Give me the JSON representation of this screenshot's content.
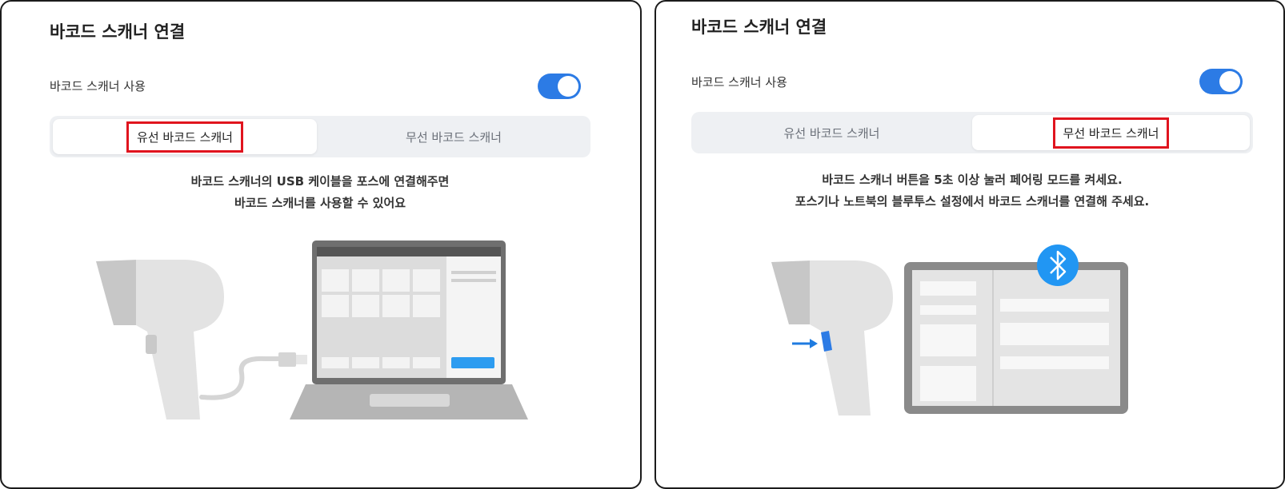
{
  "panels": [
    {
      "title": "바코드 스캐너 연결",
      "use_label": "바코드 스캐너 사용",
      "toggle_on": true,
      "tabs": [
        "유선 바코드 스캐너",
        "무선 바코드 스캐너"
      ],
      "active_tab": 0,
      "desc_line1": "바코드 스캐너의 USB 케이블을 포스에 연결해주면",
      "desc_line2": "바코드 스캐너를 사용할 수 있어요"
    },
    {
      "title": "바코드 스캐너 연결",
      "use_label": "바코드 스캐너 사용",
      "toggle_on": true,
      "tabs": [
        "유선 바코드 스캐너",
        "무선 바코드 스캐너"
      ],
      "active_tab": 1,
      "desc_line1": "바코드 스캐너 버튼을 5초 이상 눌러 페어링 모드를 켜세요.",
      "desc_line2": "포스기나 노트북의 블루투스 설정에서 바코드 스캐너를 연결해 주세요."
    }
  ],
  "colors": {
    "accent": "#2c7be5",
    "highlight": "#e0141e",
    "bluetooth": "#2196f3"
  },
  "icons": [
    "bluetooth-icon",
    "barcode-scanner-icon",
    "laptop-icon",
    "tablet-icon",
    "arrow-right-icon"
  ]
}
